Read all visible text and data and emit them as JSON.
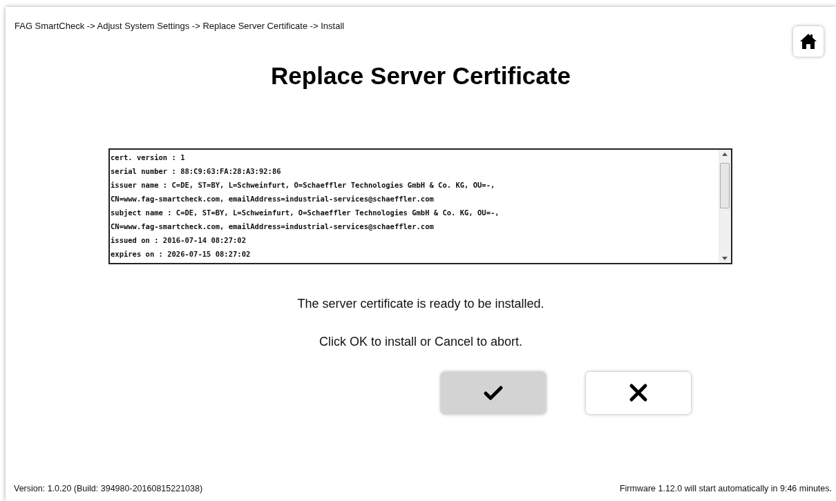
{
  "breadcrumb": "FAG SmartCheck -> Adjust System Settings -> Replace Server Certificate -> Install",
  "title": "Replace Server Certificate",
  "certificate_lines": [
    "cert. version : 1",
    "serial number : 88:C9:63:FA:28:A3:92:86",
    "issuer name : C=DE, ST=BY, L=Schweinfurt, O=Schaeffler Technologies GmbH & Co. KG, OU=-,",
    "CN=www.fag-smartcheck.com, emailAddress=industrial-services@schaeffler.com",
    "subject name : C=DE, ST=BY, L=Schweinfurt, O=Schaeffler Technologies GmbH & Co. KG, OU=-,",
    "CN=www.fag-smartcheck.com, emailAddress=industrial-services@schaeffler.com",
    "issued on : 2016-07-14 08:27:02",
    "expires on : 2026-07-15 08:27:02"
  ],
  "messages": [
    "The server certificate is ready to be installed.",
    "Click OK to install or Cancel to abort."
  ],
  "buttons": [
    {
      "kind": "confirm",
      "selected": true
    },
    {
      "kind": "cancel",
      "selected": false
    }
  ],
  "footer": {
    "version": "Version: 1.0.20 (Build: 394980-20160815221038)",
    "firmware_notice": "Firmware 1.12.0 will start automatically in 9:46 minutes."
  }
}
